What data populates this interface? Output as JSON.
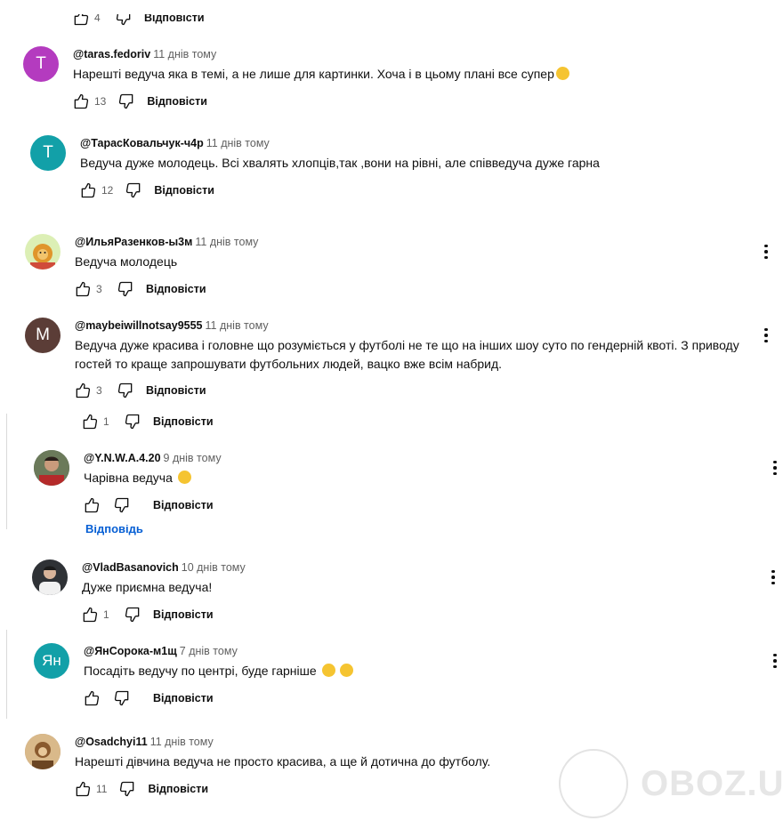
{
  "top_partial": {
    "reply_label": "Відповісти",
    "count": "4"
  },
  "comments": [
    {
      "initial": "T",
      "avatar_color": "#b43bbf",
      "author": "@taras.fedoriv",
      "time": "11 днів тому",
      "text": "Нарешті ведуча яка в темі, а не лише для картинки. Хоча і в цьому плані все супер",
      "likes": "13",
      "reply_label": "Відповісти"
    },
    {
      "initial": "T",
      "avatar_color": "#12a0a8",
      "author": "@ТарасКовальчук-ч4р",
      "time": "11 днів тому",
      "text": "Ведуча дуже молодець. Всі хвалять хлопців,так ,вони на рівні, але співведуча дуже гарна",
      "likes": "12",
      "reply_label": "Відповісти"
    },
    {
      "author": "@ИльяРазенков-ы3м",
      "time": "11 днів тому",
      "avatar_color": "#dcefb5",
      "text": "Ведуча молодець",
      "likes": "3",
      "reply_label": "Відповісти"
    },
    {
      "initial": "M",
      "avatar_color": "#5b3d37",
      "author": "@maybeiwillnotsay9555",
      "time": "11 днів тому",
      "text_line1": "Ведуча дуже красива і головне що розуміється у футболі не те що на інших шоу суто по гендерній квоті. З приводу",
      "text_line2": "гостей то краще запрошувати футбольних людей, вацко вже всім набрид.",
      "likes": "3",
      "reply_label": "Відповісти"
    },
    {
      "likes": "1",
      "reply_label": "Відповісти"
    },
    {
      "author": "@Y.N.W.A.4.20",
      "time": "9 днів тому",
      "avatar_color": "#3a4a36",
      "text": "Чарівна ведуча",
      "reply_label": "Відповісти"
    },
    {
      "author": "@VladBasanovich",
      "time": "10 днів тому",
      "avatar_color": "#c9ccd2",
      "text": "Дуже приємна ведуча!",
      "likes": "1",
      "reply_label": "Відповісти"
    },
    {
      "initial": "Ян",
      "avatar_color": "#12a0a8",
      "author": "@ЯнСорока-м1щ",
      "time": "7 днів тому",
      "text": "Посадіть ведучу по центрі, буде гарніше",
      "reply_label": "Відповісти"
    },
    {
      "author": "@Osadchyi11",
      "time": "11 днів тому",
      "avatar_color": "#b8895a",
      "text": "Нарешті дівчина ведуча не просто красива, а ще й дотична до футболу.",
      "likes": "11",
      "reply_label": "Відповісти"
    }
  ],
  "more_replies": "Відповідь",
  "watermark": "OBOZ.UA",
  "icons": {
    "like": "thumbs-up-icon",
    "dislike": "thumbs-down-icon",
    "menu": "more-vert-icon"
  }
}
